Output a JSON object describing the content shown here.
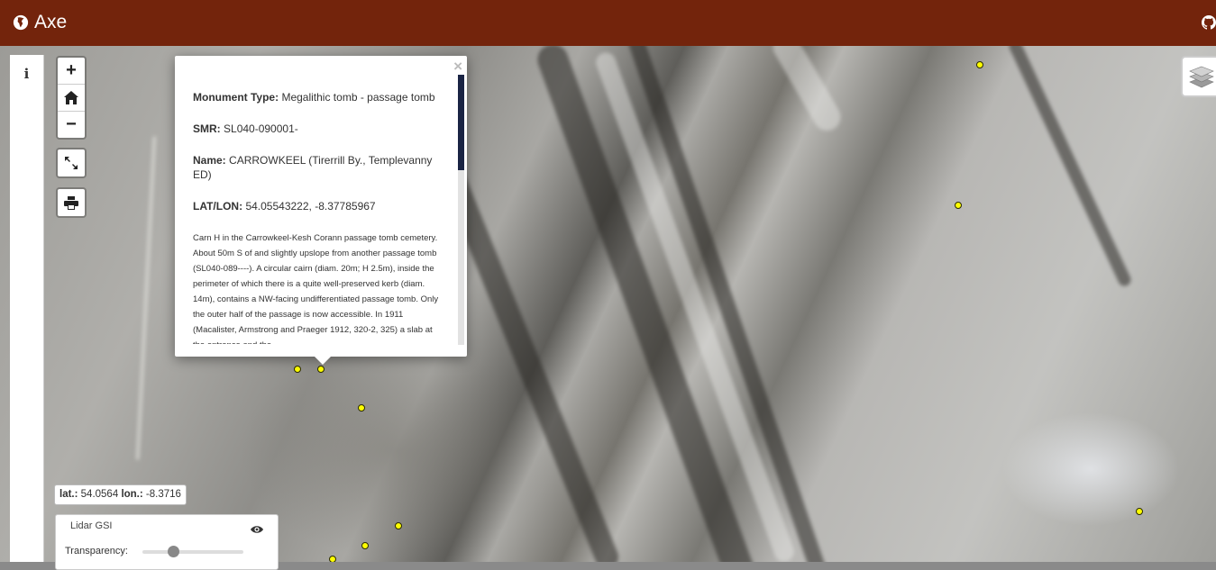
{
  "app": {
    "title": "Axe"
  },
  "controls": {
    "info_label": "i",
    "zoom_in": "+",
    "zoom_out": "−"
  },
  "popup": {
    "close": "×",
    "fields": [
      {
        "label": "Monument Type:",
        "value": "Megalithic tomb - passage tomb"
      },
      {
        "label": "SMR:",
        "value": "SL040-090001-"
      },
      {
        "label": "Name:",
        "value": "CARROWKEEL (Tirerrill By., Templevanny ED)"
      },
      {
        "label": "LAT/LON:",
        "value": "54.05543222, -8.37785967"
      }
    ],
    "description": "Carn H in the Carrowkeel-Kesh Corann passage tomb cemetery. About 50m S of and slightly upslope from another passage tomb (SL040-089----). A circular cairn (diam. 20m; H 2.5m), inside the perimeter of which there is a quite well-preserved kerb (diam. 14m), contains a NW-facing undifferentiated passage tomb. Only the outer half of the passage is now accessible. In 1911 (Macalister, Armstrong and Praeger 1912, 320-2, 325) a slab at the entrance and the"
  },
  "coords": {
    "lat_label": "lat.:",
    "lat_value": "54.0564",
    "lon_label": "lon.:",
    "lon_value": "-8.3716"
  },
  "layer_panel": {
    "layer_name": "Lidar GSI",
    "transparency_label": "Transparency:",
    "transparency_value": 0.3
  },
  "colors": {
    "header": "#73240c",
    "marker": "#ffff00",
    "scroll_thumb": "#1a2444"
  },
  "icons": [
    "globe-icon",
    "github-icon",
    "home-icon",
    "fullscreen-icon",
    "print-icon",
    "layers-icon",
    "eye-icon"
  ]
}
